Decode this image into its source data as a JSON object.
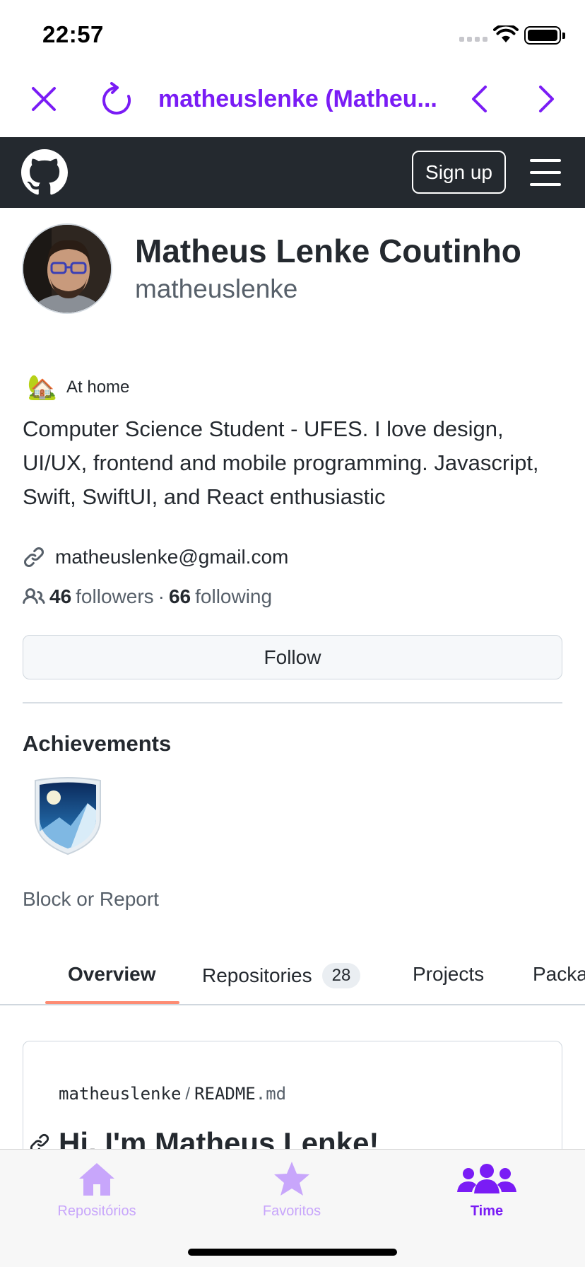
{
  "status_bar": {
    "time": "22:57"
  },
  "browser": {
    "title": "matheuslenke (Matheu...",
    "close_icon": "close-icon",
    "reload_icon": "reload-icon",
    "back_icon": "chevron-left-icon",
    "forward_icon": "chevron-right-icon",
    "accent": "#7a1cf5"
  },
  "github_header": {
    "signup_label": "Sign up"
  },
  "profile": {
    "name": "Matheus Lenke Coutinho",
    "login": "matheuslenke",
    "status_emoji": "🏡",
    "status_text": "At home",
    "bio": "Computer Science Student - UFES. I love design, UI/UX, frontend and mobile programming. Javascript, Swift, SwiftUI, and React enthusiastic",
    "email": "matheuslenke@gmail.com",
    "followers_count": "46",
    "followers_label": "followers",
    "separator": "·",
    "following_count": "66",
    "following_label": "following",
    "follow_button": "Follow",
    "achievements_title": "Achievements",
    "block_report": "Block or Report"
  },
  "tabs": [
    {
      "label": "Overview"
    },
    {
      "label": "Repositories",
      "count": "28"
    },
    {
      "label": "Projects"
    },
    {
      "label": "Packa"
    }
  ],
  "readme": {
    "owner": "matheuslenke",
    "slash": "/",
    "file": "README",
    "ext": ".md",
    "heading": "Hi, I'm Matheus Lenke!"
  },
  "tabbar": {
    "items": [
      {
        "label": "Repositórios",
        "icon": "house-icon"
      },
      {
        "label": "Favoritos",
        "icon": "star-icon"
      },
      {
        "label": "Time",
        "icon": "people-icon"
      }
    ],
    "active_color": "#7a1cf5",
    "inactive_color": "#c8a6fb"
  }
}
